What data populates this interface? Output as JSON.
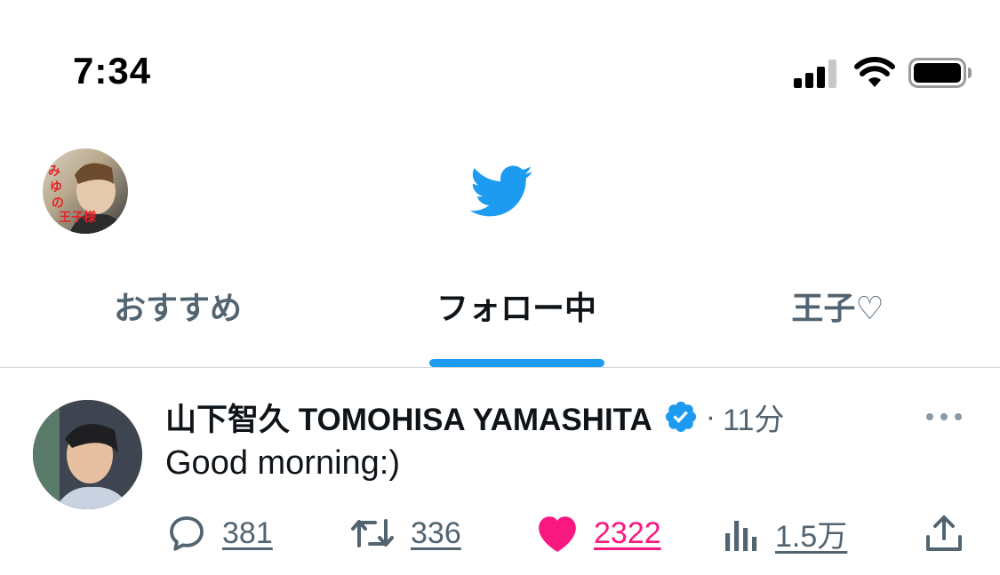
{
  "status_bar": {
    "time": "7:34",
    "icons": [
      "cellular-signal-icon",
      "wifi-icon",
      "battery-icon"
    ]
  },
  "header": {
    "logo": "twitter-bird-icon",
    "brand_color": "#1d9bf0",
    "account_avatar_caption": "みゆの王子様"
  },
  "tabs": [
    {
      "label": "おすすめ",
      "active": false
    },
    {
      "label": "フォロー中",
      "active": true
    },
    {
      "label": "王子♡",
      "active": false
    }
  ],
  "tweet": {
    "author": "山下智久 TOMOHISA YAMASHITA",
    "verified": true,
    "separator": "·",
    "time": "11分",
    "text": "Good morning:)",
    "actions": {
      "reply_count": "381",
      "retweet_count": "336",
      "like_count": "2322",
      "like_color": "#f91880",
      "views_count": "1.5万"
    }
  }
}
